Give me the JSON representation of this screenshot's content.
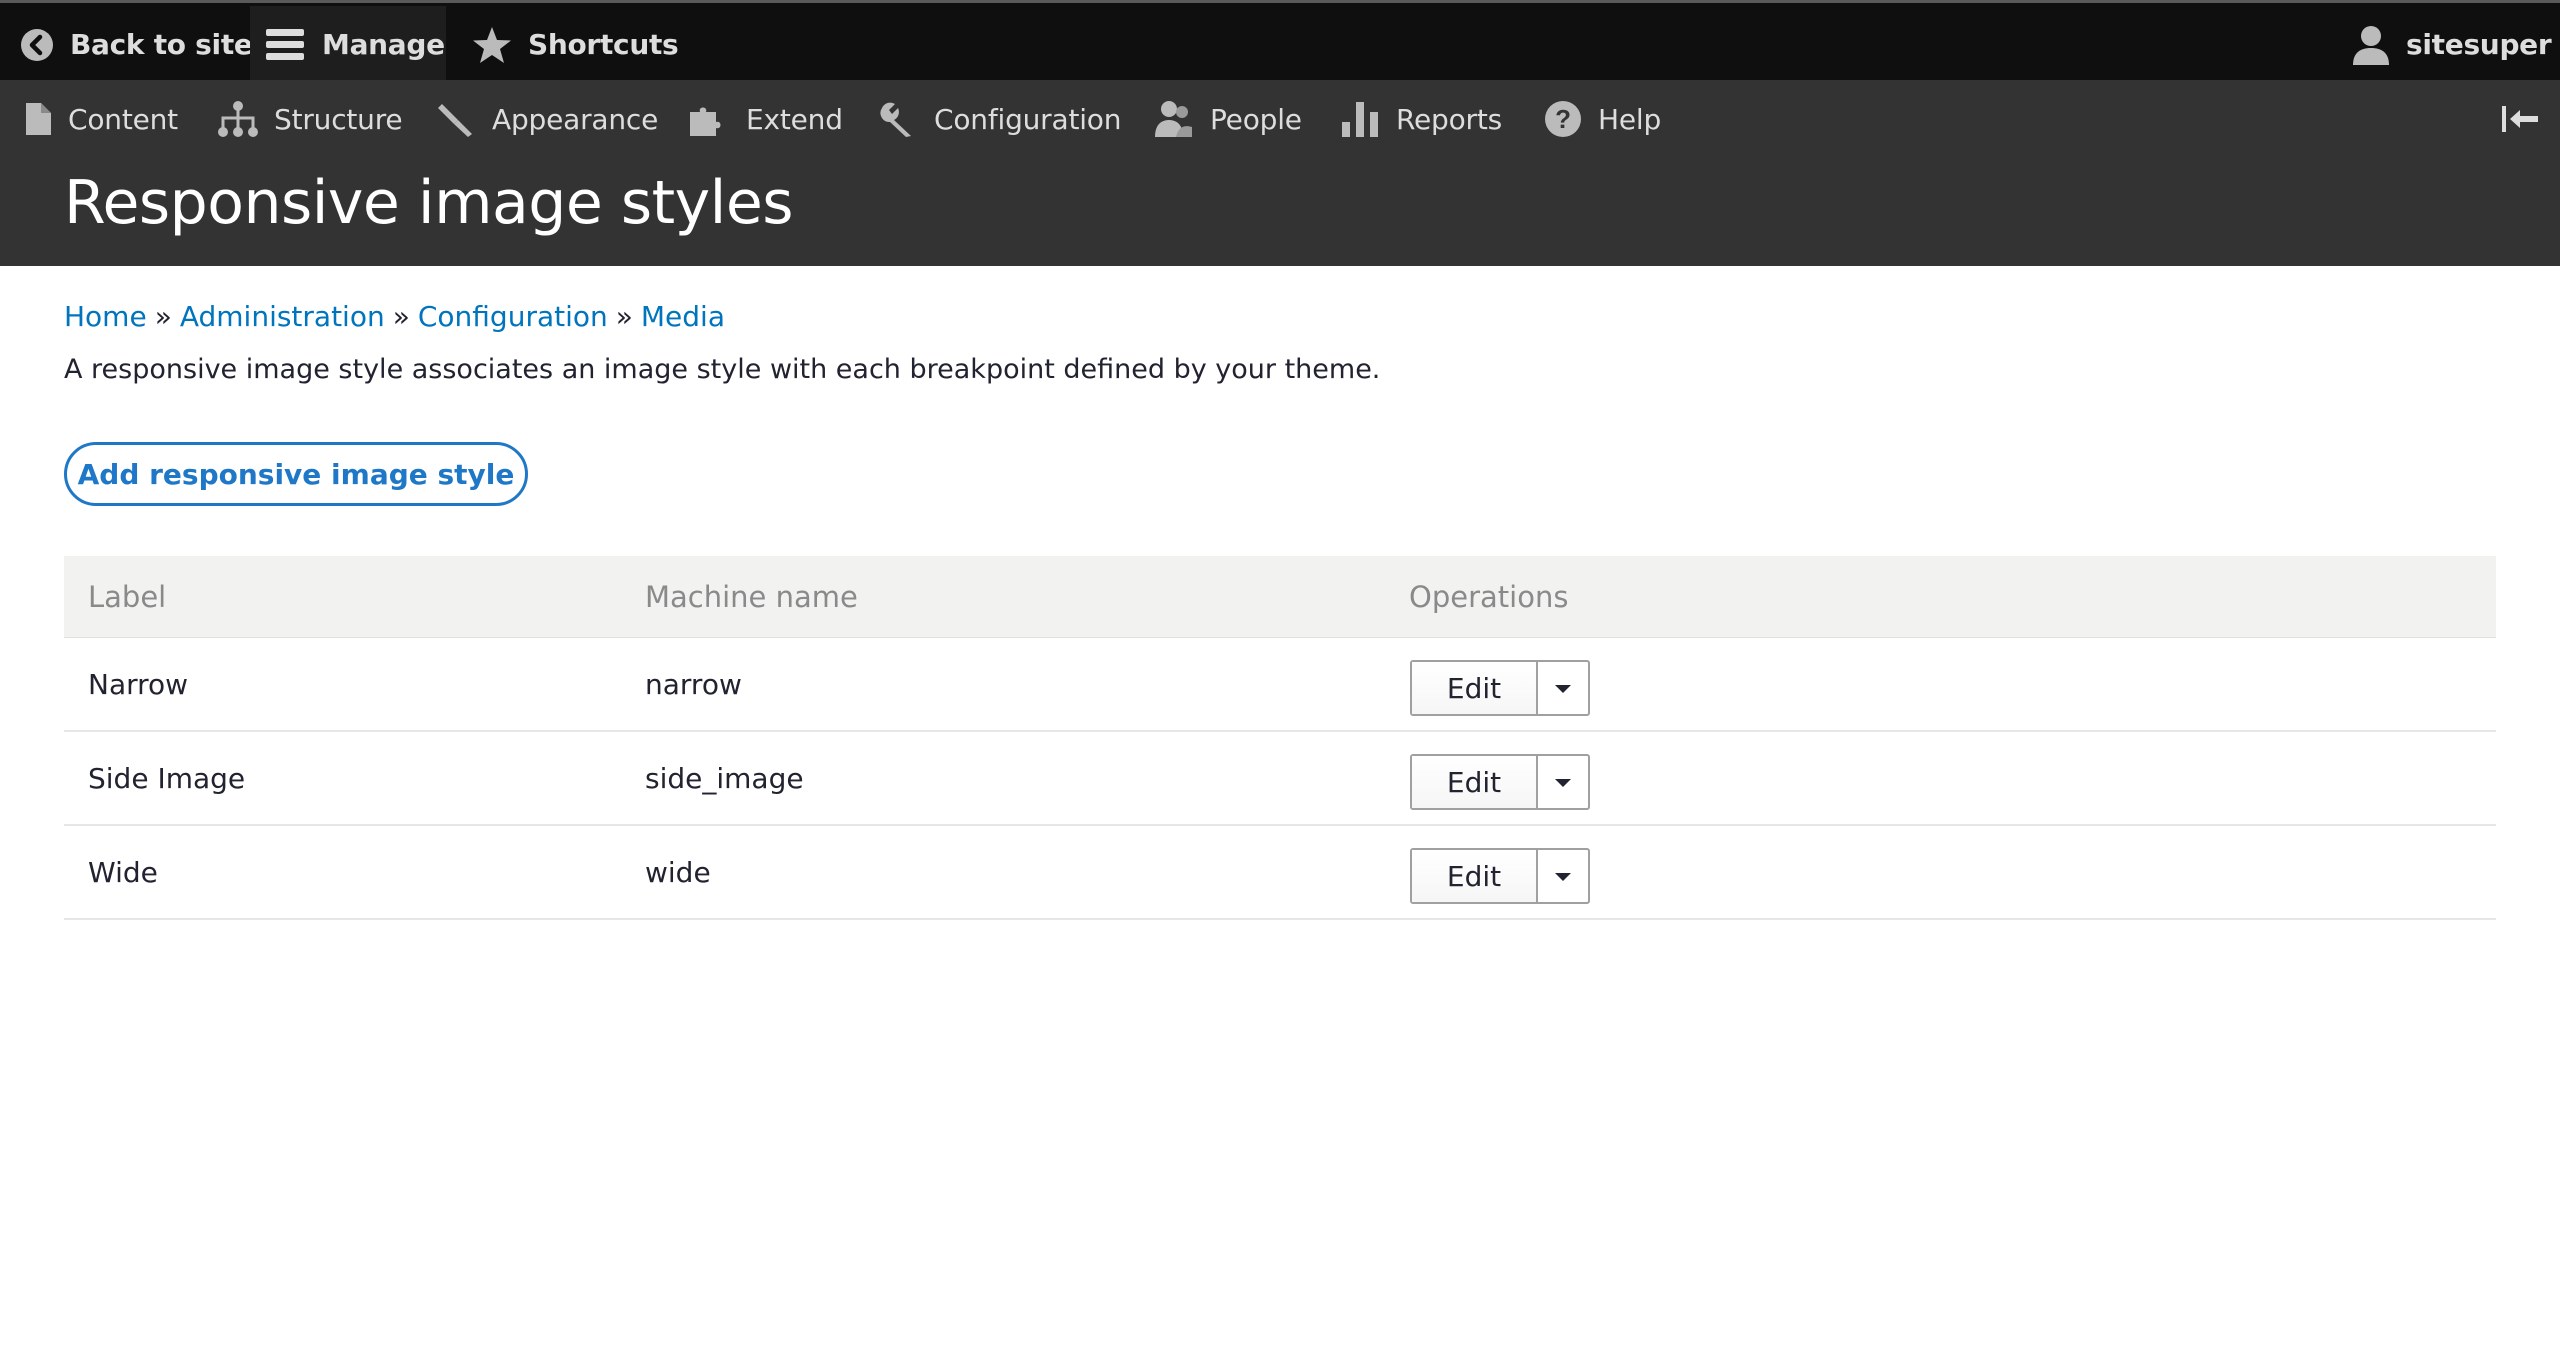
{
  "toolbar": {
    "back_label": "Back to site",
    "manage_label": "Manage",
    "shortcuts_label": "Shortcuts",
    "user_label": "sitesuper"
  },
  "tray": {
    "items": [
      {
        "label": "Content",
        "icon": "file-icon"
      },
      {
        "label": "Structure",
        "icon": "sitemap-icon"
      },
      {
        "label": "Appearance",
        "icon": "paintbrush-icon"
      },
      {
        "label": "Extend",
        "icon": "puzzle-icon"
      },
      {
        "label": "Configuration",
        "icon": "wrench-icon"
      },
      {
        "label": "People",
        "icon": "people-icon"
      },
      {
        "label": "Reports",
        "icon": "bar-chart-icon"
      },
      {
        "label": "Help",
        "icon": "help-icon"
      }
    ]
  },
  "page": {
    "title": "Responsive image styles",
    "description": "A responsive image style associates an image style with each breakpoint defined by your theme."
  },
  "breadcrumb": {
    "items": [
      "Home",
      "Administration",
      "Configuration",
      "Media"
    ],
    "separator": "»"
  },
  "actions": {
    "add_label": "Add responsive image style"
  },
  "table": {
    "headers": [
      "Label",
      "Machine name",
      "Operations"
    ],
    "rows": [
      {
        "label": "Narrow",
        "machine": "narrow",
        "op": "Edit"
      },
      {
        "label": "Side Image",
        "machine": "side_image",
        "op": "Edit"
      },
      {
        "label": "Wide",
        "machine": "wide",
        "op": "Edit"
      }
    ]
  },
  "colors": {
    "toolbar_bg": "#0f0f0f",
    "tray_bg": "#333333",
    "link": "#0074bd",
    "button_accent": "#1f78c7",
    "table_header_bg": "#f2f2f0"
  }
}
